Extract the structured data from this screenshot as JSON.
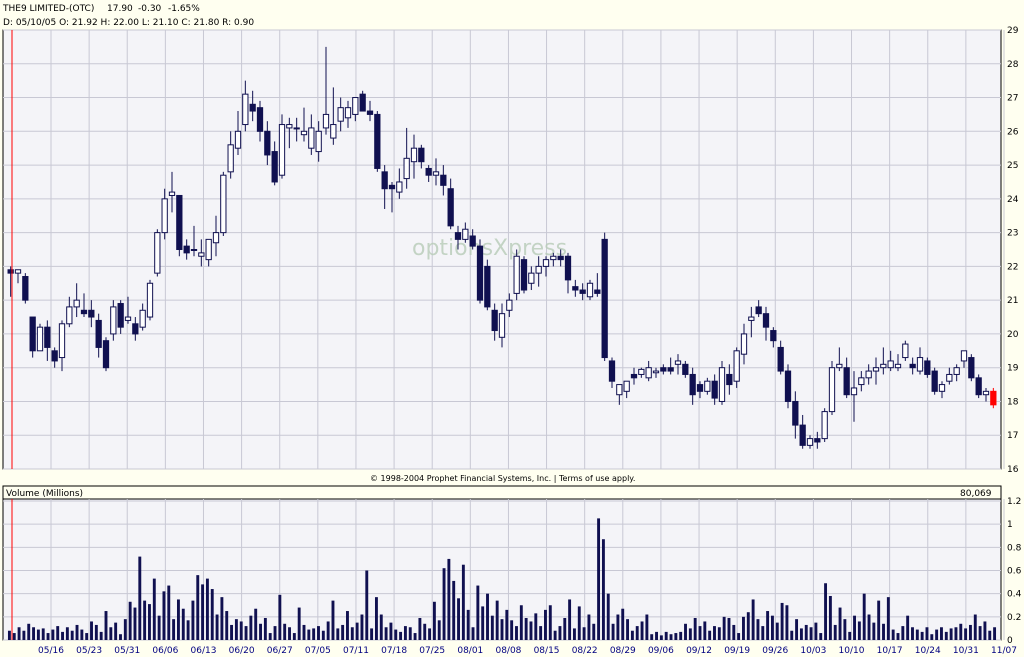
{
  "header": {
    "symbol": "THE9 LIMITED-(OTC)",
    "last": "17.90",
    "change": "-0.30",
    "change_pct": "-1.65%",
    "ohlc_line": "D: 05/10/05  O: 21.92  H: 22.00  L: 21.10  C: 21.80  R: 0.90"
  },
  "watermark": "optionsXpress",
  "copyright": "© 1998-2004 Prophet Financial Systems, Inc. | Terms of use apply.",
  "volume_panel": {
    "title": "Volume (Millions)",
    "last_value": "80,069"
  },
  "colors": {
    "background": "#fffff0",
    "plot_bg": "#f4f4f8",
    "grid": "#c8c8d4",
    "down_candle": "#101050",
    "up_candle": "#ffffff",
    "last_candle": "#ff0000",
    "volume_bar": "#101050",
    "cursor_line": "#ff0000",
    "header_change": "#ff0000",
    "date_label": "#000080"
  },
  "chart_data": [
    {
      "type": "candlestick",
      "title": "THE9 LIMITED-(OTC)",
      "ylim": [
        16,
        29
      ],
      "y_ticks": [
        "16",
        "17",
        "18",
        "19",
        "20",
        "21",
        "22",
        "23",
        "24",
        "25",
        "26",
        "27",
        "28",
        "29"
      ],
      "x_ticks": [
        "05/16",
        "05/23",
        "05/31",
        "06/06",
        "06/13",
        "06/20",
        "06/27",
        "07/05",
        "07/11",
        "07/18",
        "07/25",
        "08/01",
        "08/08",
        "08/15",
        "08/22",
        "08/29",
        "09/06",
        "09/12",
        "09/19",
        "09/26",
        "10/03",
        "10/10",
        "10/17",
        "10/24",
        "10/31",
        "11/07"
      ],
      "grid": true,
      "ohlc": [
        [
          21.9,
          22.0,
          21.1,
          21.8
        ],
        [
          21.8,
          21.9,
          21.5,
          21.9
        ],
        [
          21.7,
          21.8,
          20.9,
          21.0
        ],
        [
          20.5,
          20.5,
          19.3,
          19.5
        ],
        [
          19.5,
          20.3,
          19.5,
          20.2
        ],
        [
          20.2,
          20.4,
          19.2,
          19.6
        ],
        [
          19.5,
          19.6,
          19.0,
          19.2
        ],
        [
          19.3,
          20.4,
          18.9,
          20.3
        ],
        [
          20.3,
          21.1,
          20.2,
          20.8
        ],
        [
          20.8,
          21.5,
          20.5,
          21.0
        ],
        [
          20.7,
          21.2,
          20.5,
          20.6
        ],
        [
          20.7,
          21.0,
          20.2,
          20.5
        ],
        [
          20.4,
          20.6,
          19.3,
          19.6
        ],
        [
          19.8,
          19.9,
          18.9,
          19.0
        ],
        [
          20.0,
          21.0,
          19.8,
          20.8
        ],
        [
          20.9,
          21.0,
          20.0,
          20.2
        ],
        [
          20.4,
          21.1,
          20.3,
          20.5
        ],
        [
          20.3,
          20.5,
          19.8,
          20.0
        ],
        [
          20.2,
          20.9,
          20.1,
          20.7
        ],
        [
          20.5,
          21.6,
          20.4,
          21.5
        ],
        [
          21.8,
          23.1,
          21.7,
          23.0
        ],
        [
          23.0,
          24.3,
          22.8,
          24.0
        ],
        [
          24.1,
          24.8,
          23.6,
          24.2
        ],
        [
          24.1,
          24.1,
          22.3,
          22.5
        ],
        [
          22.6,
          22.8,
          22.2,
          22.4
        ],
        [
          22.5,
          23.2,
          22.3,
          22.5
        ],
        [
          22.3,
          22.8,
          22.0,
          22.4
        ],
        [
          22.2,
          22.7,
          22.0,
          22.8
        ],
        [
          22.7,
          23.5,
          22.3,
          23.0
        ],
        [
          23.0,
          24.8,
          22.9,
          24.7
        ],
        [
          24.8,
          26.0,
          24.6,
          25.6
        ],
        [
          25.5,
          26.6,
          25.3,
          26.0
        ],
        [
          26.2,
          27.5,
          26.0,
          27.1
        ],
        [
          26.8,
          27.2,
          26.3,
          26.6
        ],
        [
          26.7,
          26.9,
          25.7,
          26.0
        ],
        [
          26.0,
          26.3,
          25.0,
          25.3
        ],
        [
          25.4,
          25.7,
          24.4,
          24.5
        ],
        [
          24.7,
          26.5,
          24.6,
          26.2
        ],
        [
          26.1,
          26.4,
          25.5,
          26.2
        ],
        [
          26.1,
          26.4,
          25.7,
          26.1
        ],
        [
          25.9,
          26.7,
          25.7,
          26.0
        ],
        [
          25.5,
          26.5,
          25.3,
          26.1
        ],
        [
          25.4,
          26.3,
          25.1,
          26.0
        ],
        [
          26.1,
          28.5,
          25.9,
          26.5
        ],
        [
          25.8,
          27.3,
          25.6,
          26.2
        ],
        [
          26.3,
          27.0,
          26.0,
          26.7
        ],
        [
          26.4,
          26.9,
          26.1,
          26.7
        ],
        [
          26.5,
          27.0,
          26.3,
          27.0
        ],
        [
          27.1,
          27.2,
          26.6,
          26.6
        ],
        [
          26.6,
          26.9,
          26.3,
          26.5
        ],
        [
          26.5,
          26.6,
          24.8,
          24.9
        ],
        [
          24.8,
          25.0,
          23.7,
          24.3
        ],
        [
          24.4,
          24.5,
          23.6,
          24.3
        ],
        [
          24.2,
          24.9,
          24.0,
          24.5
        ],
        [
          24.6,
          26.1,
          24.3,
          25.2
        ],
        [
          25.1,
          25.9,
          24.6,
          25.5
        ],
        [
          25.5,
          25.6,
          24.9,
          25.1
        ],
        [
          24.9,
          25.0,
          24.5,
          24.7
        ],
        [
          24.7,
          25.2,
          24.4,
          24.8
        ],
        [
          24.7,
          25.0,
          24.1,
          24.4
        ],
        [
          24.3,
          24.6,
          23.1,
          23.2
        ],
        [
          23.0,
          23.2,
          22.5,
          22.8
        ],
        [
          22.8,
          23.3,
          22.7,
          23.1
        ],
        [
          22.9,
          23.1,
          22.5,
          22.6
        ],
        [
          22.6,
          22.8,
          20.9,
          21.0
        ],
        [
          22.0,
          22.2,
          20.7,
          20.8
        ],
        [
          20.7,
          20.9,
          19.8,
          20.1
        ],
        [
          19.9,
          20.9,
          19.6,
          20.6
        ],
        [
          20.7,
          21.2,
          20.5,
          21.0
        ],
        [
          21.2,
          22.5,
          21.0,
          22.3
        ],
        [
          22.2,
          22.3,
          21.2,
          21.3
        ],
        [
          21.5,
          22.0,
          21.3,
          21.8
        ],
        [
          21.8,
          22.3,
          21.4,
          22.0
        ],
        [
          22.0,
          22.3,
          21.7,
          22.2
        ],
        [
          22.2,
          22.4,
          22.0,
          22.3
        ],
        [
          22.3,
          22.5,
          22.0,
          22.2
        ],
        [
          22.3,
          22.4,
          21.2,
          21.6
        ],
        [
          21.4,
          21.6,
          21.1,
          21.3
        ],
        [
          21.3,
          21.5,
          21.0,
          21.2
        ],
        [
          21.1,
          21.6,
          21.0,
          21.5
        ],
        [
          21.3,
          21.8,
          21.1,
          21.2
        ],
        [
          22.8,
          23.0,
          19.2,
          19.3
        ],
        [
          19.2,
          19.3,
          18.4,
          18.6
        ],
        [
          18.2,
          18.3,
          17.9,
          18.5
        ],
        [
          18.3,
          18.6,
          18.1,
          18.6
        ],
        [
          18.8,
          19.0,
          18.5,
          18.7
        ],
        [
          18.8,
          19.0,
          18.7,
          18.95
        ],
        [
          18.7,
          19.2,
          18.6,
          19.0
        ],
        [
          18.85,
          19.0,
          18.7,
          18.9
        ],
        [
          19.0,
          19.1,
          18.8,
          18.9
        ],
        [
          19.0,
          19.3,
          18.8,
          18.9
        ],
        [
          19.1,
          19.4,
          18.8,
          19.2
        ],
        [
          19.1,
          19.2,
          18.7,
          18.8
        ],
        [
          18.8,
          19.0,
          17.9,
          18.2
        ],
        [
          18.5,
          18.6,
          18.1,
          18.3
        ],
        [
          18.3,
          18.7,
          18.2,
          18.6
        ],
        [
          18.6,
          18.8,
          17.9,
          18.1
        ],
        [
          18.0,
          19.2,
          17.9,
          19.0
        ],
        [
          18.8,
          19.1,
          18.2,
          18.5
        ],
        [
          18.6,
          19.6,
          18.4,
          19.5
        ],
        [
          19.4,
          20.3,
          19.1,
          20.0
        ],
        [
          20.4,
          20.8,
          19.9,
          20.5
        ],
        [
          20.8,
          21.0,
          20.5,
          20.6
        ],
        [
          20.6,
          20.8,
          19.8,
          20.2
        ],
        [
          20.1,
          20.2,
          19.6,
          19.8
        ],
        [
          19.6,
          19.8,
          18.8,
          18.9
        ],
        [
          18.9,
          19.1,
          17.8,
          18.0
        ],
        [
          18.0,
          18.3,
          16.9,
          17.3
        ],
        [
          17.3,
          17.6,
          16.6,
          16.7
        ],
        [
          16.7,
          17.0,
          16.6,
          16.9
        ],
        [
          16.9,
          17.1,
          16.6,
          16.8
        ],
        [
          16.9,
          17.8,
          16.8,
          17.7
        ],
        [
          17.7,
          19.2,
          17.6,
          19.0
        ],
        [
          19.0,
          19.6,
          18.9,
          19.1
        ],
        [
          19.0,
          19.3,
          18.1,
          18.2
        ],
        [
          18.2,
          18.9,
          17.4,
          18.4
        ],
        [
          18.5,
          18.9,
          18.3,
          18.7
        ],
        [
          18.7,
          19.1,
          18.5,
          18.9
        ],
        [
          18.9,
          19.3,
          18.5,
          19.0
        ],
        [
          19.0,
          19.6,
          18.8,
          19.1
        ],
        [
          19.0,
          19.5,
          18.9,
          19.2
        ],
        [
          19.0,
          19.4,
          18.9,
          19.1
        ],
        [
          19.3,
          19.8,
          19.2,
          19.7
        ],
        [
          19.1,
          19.3,
          18.8,
          19.0
        ],
        [
          18.9,
          19.6,
          18.8,
          19.3
        ],
        [
          19.2,
          19.3,
          18.7,
          18.8
        ],
        [
          18.9,
          19.0,
          18.2,
          18.3
        ],
        [
          18.3,
          18.6,
          18.1,
          18.5
        ],
        [
          18.6,
          19.0,
          18.5,
          18.8
        ],
        [
          18.8,
          19.1,
          18.6,
          19.0
        ],
        [
          19.2,
          19.5,
          19.0,
          19.5
        ],
        [
          19.3,
          19.4,
          18.6,
          18.7
        ],
        [
          18.7,
          18.8,
          18.1,
          18.2
        ],
        [
          18.2,
          18.4,
          18.0,
          18.3
        ],
        [
          18.3,
          18.4,
          17.8,
          17.9
        ]
      ]
    },
    {
      "type": "bar",
      "title": "Volume (Millions)",
      "ylim": [
        0,
        1.2
      ],
      "y_ticks": [
        "0",
        "0.2",
        "0.4",
        "0.6",
        "0.8",
        "1",
        "1.2"
      ],
      "values": [
        0.08,
        0.06,
        0.11,
        0.08,
        0.14,
        0.11,
        0.09,
        0.1,
        0.06,
        0.09,
        0.12,
        0.07,
        0.11,
        0.08,
        0.13,
        0.09,
        0.06,
        0.16,
        0.13,
        0.07,
        0.25,
        0.11,
        0.15,
        0.05,
        0.18,
        0.33,
        0.28,
        0.72,
        0.34,
        0.31,
        0.53,
        0.21,
        0.42,
        0.47,
        0.18,
        0.35,
        0.27,
        0.17,
        0.34,
        0.56,
        0.48,
        0.53,
        0.44,
        0.22,
        0.37,
        0.25,
        0.13,
        0.18,
        0.16,
        0.12,
        0.21,
        0.27,
        0.14,
        0.19,
        0.06,
        0.12,
        0.39,
        0.14,
        0.11,
        0.06,
        0.28,
        0.13,
        0.09,
        0.1,
        0.12,
        0.08,
        0.16,
        0.34,
        0.1,
        0.13,
        0.25,
        0.11,
        0.15,
        0.22,
        0.6,
        0.1,
        0.37,
        0.22,
        0.11,
        0.15,
        0.09,
        0.07,
        0.12,
        0.11,
        0.06,
        0.19,
        0.14,
        0.1,
        0.33,
        0.17,
        0.62,
        0.7,
        0.51,
        0.36,
        0.65,
        0.26,
        0.11,
        0.47,
        0.29,
        0.4,
        0.21,
        0.34,
        0.18,
        0.26,
        0.17,
        0.12,
        0.3,
        0.19,
        0.16,
        0.23,
        0.12,
        0.26,
        0.3,
        0.08,
        0.12,
        0.19,
        0.35,
        0.1,
        0.29,
        0.11,
        0.22,
        0.14,
        1.05,
        0.87,
        0.4,
        0.14,
        0.22,
        0.27,
        0.18,
        0.08,
        0.12,
        0.16,
        0.22,
        0.05,
        0.07,
        0.04,
        0.07,
        0.05,
        0.06,
        0.07,
        0.14,
        0.1,
        0.19,
        0.12,
        0.16,
        0.08,
        0.12,
        0.11,
        0.2,
        0.19,
        0.13,
        0.06,
        0.2,
        0.24,
        0.35,
        0.18,
        0.12,
        0.25,
        0.21,
        0.15,
        0.32,
        0.3,
        0.08,
        0.18,
        0.1,
        0.13,
        0.11,
        0.15,
        0.06,
        0.49,
        0.38,
        0.13,
        0.28,
        0.18,
        0.07,
        0.21,
        0.16,
        0.4,
        0.22,
        0.15,
        0.34,
        0.14,
        0.37,
        0.09,
        0.06,
        0.12,
        0.21,
        0.11,
        0.09,
        0.07,
        0.11,
        0.05,
        0.09,
        0.11,
        0.07,
        0.1,
        0.11,
        0.14,
        0.1,
        0.13,
        0.22,
        0.12,
        0.16,
        0.08,
        0.11
      ]
    }
  ]
}
